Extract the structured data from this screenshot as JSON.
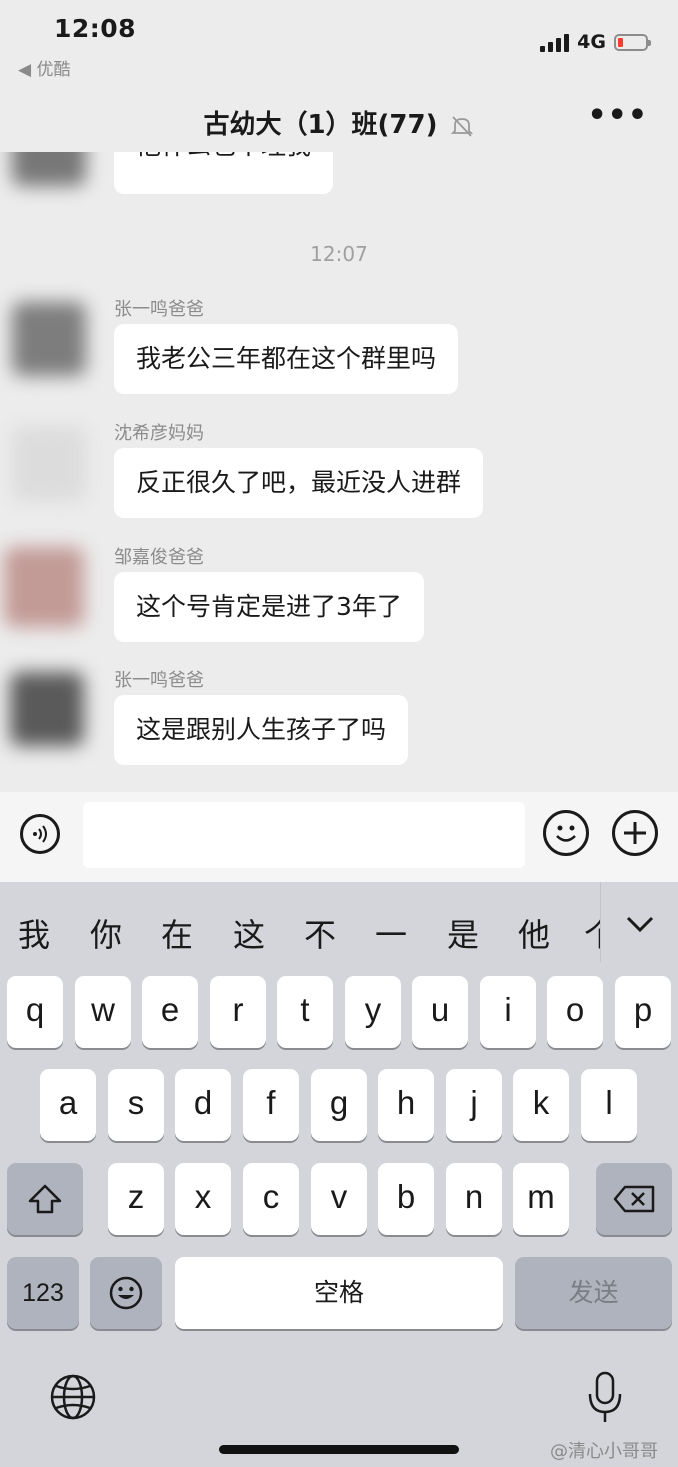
{
  "status_bar": {
    "time": "12:08",
    "back_app": "◀ 优酷",
    "network": "4G",
    "battery_level": 0.18
  },
  "nav": {
    "title": "古幼大（1）班(77)",
    "more": "•••"
  },
  "chat": {
    "cut_message": "他什么也不理我",
    "timestamp": "12:07",
    "messages": [
      {
        "sender": "张一鸣爸爸",
        "text": "我老公三年都在这个群里吗"
      },
      {
        "sender": "沈希彦妈妈",
        "text": "反正很久了吧，最近没人进群"
      },
      {
        "sender": "邹嘉俊爸爸",
        "text": "这个号肯定是进了3年了"
      },
      {
        "sender": "张一鸣爸爸",
        "text": "这是跟别人生孩子了吗"
      }
    ]
  },
  "input": {
    "value": "",
    "placeholder": ""
  },
  "keyboard": {
    "candidates": [
      "我",
      "你",
      "在",
      "这",
      "不",
      "一",
      "是",
      "他",
      "个"
    ],
    "row1": [
      "q",
      "w",
      "e",
      "r",
      "t",
      "y",
      "u",
      "i",
      "o",
      "p"
    ],
    "row2": [
      "a",
      "s",
      "d",
      "f",
      "g",
      "h",
      "j",
      "k",
      "l"
    ],
    "row3": [
      "z",
      "x",
      "c",
      "v",
      "b",
      "n",
      "m"
    ],
    "numbers_key": "123",
    "space_key": "空格",
    "send_key": "发送"
  },
  "watermark": "@清心小哥哥"
}
